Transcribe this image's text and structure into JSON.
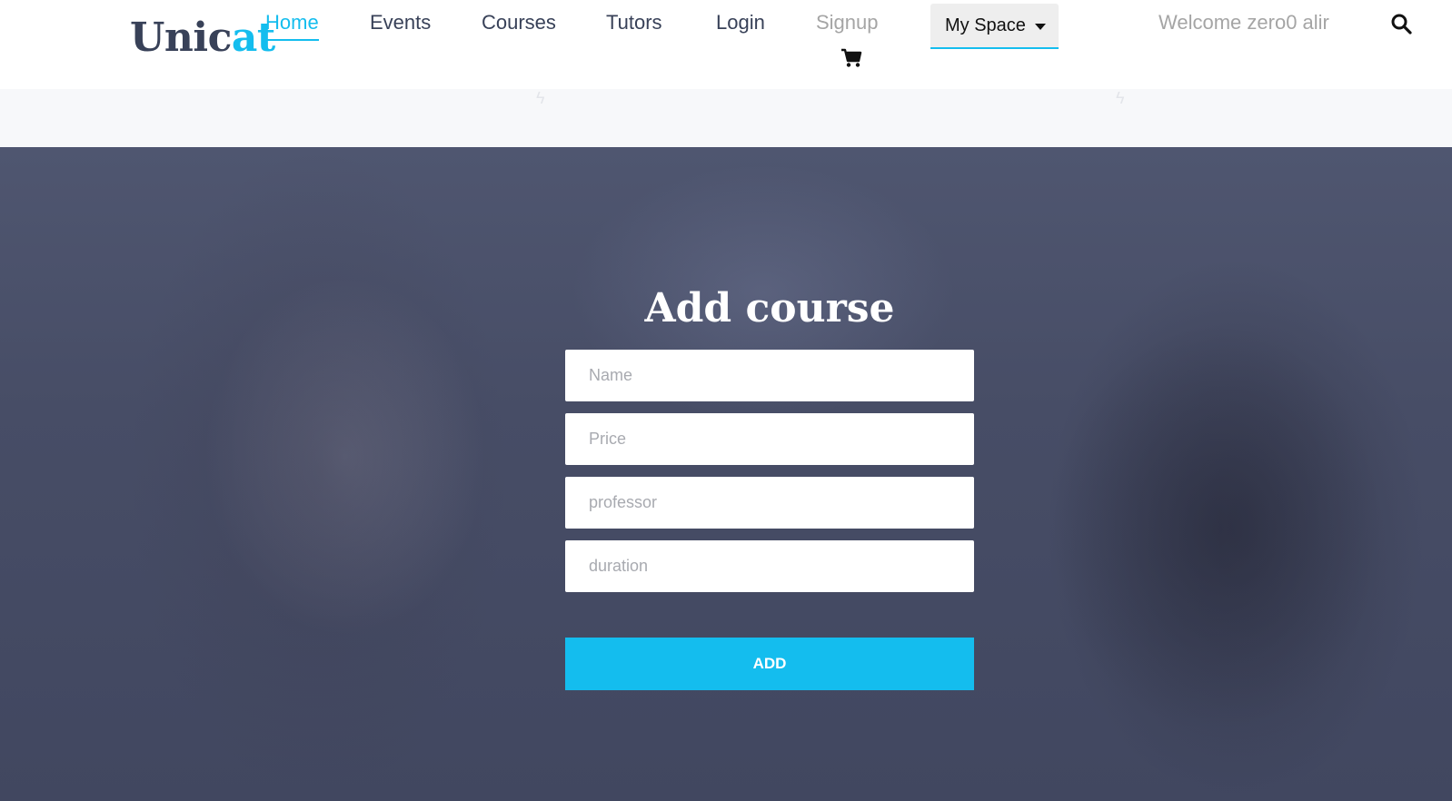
{
  "brand": {
    "prefix": "Unic",
    "accent": "at"
  },
  "nav": {
    "home": "Home",
    "events": "Events",
    "courses": "Courses",
    "tutors": "Tutors",
    "login": "Login",
    "signup": "Signup"
  },
  "my_space": "My Space",
  "welcome": "Welcome zero0 alir",
  "form": {
    "title": "Add course",
    "fields": {
      "name": "Name",
      "price": "Price",
      "professor": "professor",
      "duration": "duration"
    },
    "submit": "ADD"
  },
  "colors": {
    "accent": "#14bdee",
    "text_dark": "#384158",
    "muted": "#a5a5a5",
    "hero_overlay": "#474d66"
  },
  "icons": {
    "cart": "shopping-cart-icon",
    "search": "search-icon"
  }
}
